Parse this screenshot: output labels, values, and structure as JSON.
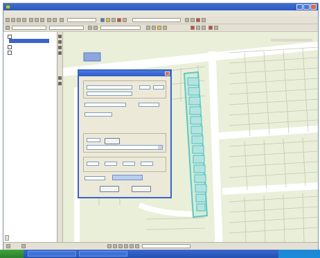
{
  "window": {
    "title": "",
    "menus": [
      "",
      "",
      "",
      "",
      "",
      "",
      ""
    ]
  },
  "toc": {
    "layers": [
      "",
      "",
      "",
      ""
    ],
    "tab_label": ""
  },
  "status": {
    "left_text": "",
    "right_text": ""
  },
  "dialog": {
    "title": ""
  },
  "colors": {
    "map_background": "#e9efd9",
    "road": "#ffffff",
    "parcel_line": "#c9c6b3",
    "highlight_parcel": "#b3e3e0",
    "highlight_outline": "#5cc6c8",
    "titlebar": "#2b58c0",
    "taskbar": "#2450b0"
  },
  "icons": [
    "app-icon",
    "minimize-icon",
    "maximize-icon",
    "close-icon",
    "checkbox-icon",
    "start-icon"
  ]
}
